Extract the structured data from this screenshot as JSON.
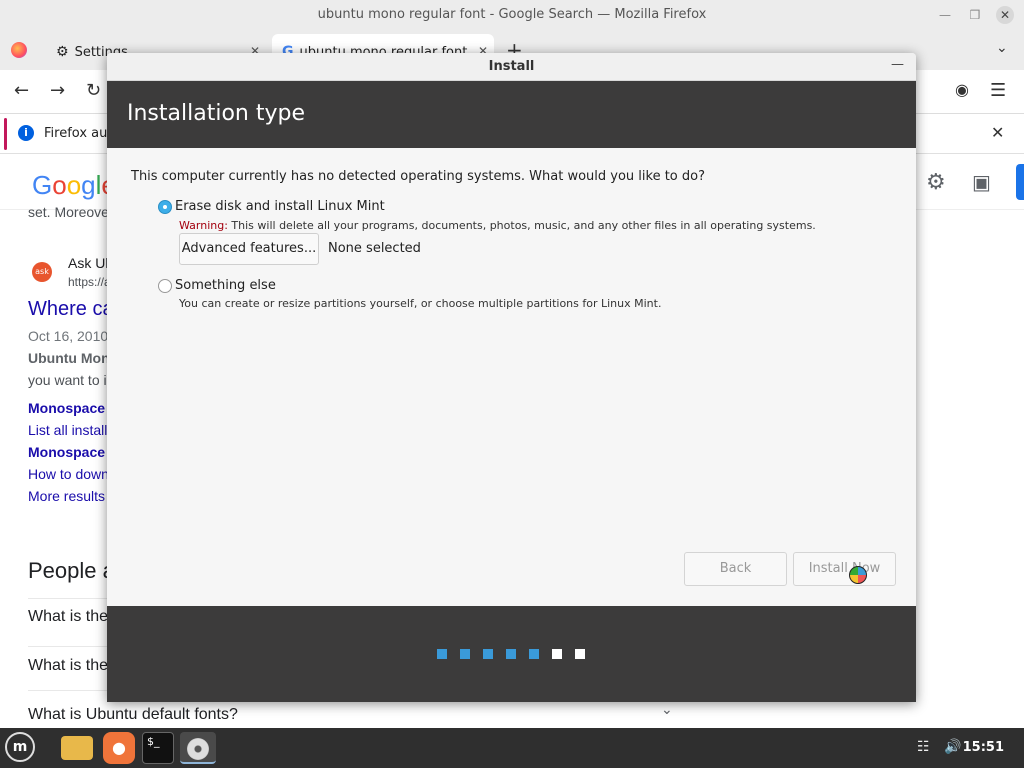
{
  "firefox": {
    "window_title": "ubuntu mono regular font - Google Search — Mozilla Firefox",
    "tabs": [
      {
        "label": "Settings",
        "icon": "gear-icon"
      },
      {
        "label": "ubuntu mono regular font",
        "icon": "google-icon"
      }
    ],
    "infobar_text": "Firefox aut"
  },
  "google": {
    "logo": [
      "G",
      "o",
      "o",
      "g",
      "l",
      "e"
    ],
    "snippet_top": "set. Moreove",
    "result_site": "Ask Ul",
    "result_url": "https://a",
    "result_title": "Where ca",
    "result_date": "Oct 16, 2010",
    "result_bold": "Ubuntu Mon",
    "result_line": "you want to i",
    "sub_links": [
      {
        "text": "Monospace",
        "bold": true
      },
      {
        "text": "List all install",
        "bold": false
      },
      {
        "text": "Monospace",
        "bold": true
      },
      {
        "text": "How to down",
        "bold": false
      }
    ],
    "more_results": "More results",
    "people_heading": "People a",
    "questions": [
      "What is the",
      "What is the",
      "What is Ubuntu default fonts?"
    ]
  },
  "dialog": {
    "title": "Install",
    "heading": "Installation type",
    "question": "This computer currently has no detected operating systems. What would you like to do?",
    "options": [
      {
        "label": "Erase disk and install Linux Mint",
        "checked": true
      },
      {
        "label": "Something else",
        "checked": false
      }
    ],
    "warning_word": "Warning:",
    "warning_text": " This will delete all your programs, documents, photos, music, and any other files in all operating systems.",
    "advanced_button": "Advanced features...",
    "advanced_value": "None selected",
    "something_else_desc": "You can create or resize partitions yourself, or choose multiple partitions for Linux Mint.",
    "back_button": "Back",
    "install_button": "Install Now",
    "progress": {
      "done": 5,
      "total": 7
    },
    "colors": {
      "header_bg": "#3c3b3b",
      "dot_done": "#3a9ad9",
      "dot_todo": "#ffffff"
    }
  },
  "taskbar": {
    "clock": "15:51",
    "items": [
      "mint-menu-icon",
      "files-icon",
      "firefox-icon",
      "terminal-icon",
      "disc-icon"
    ]
  }
}
